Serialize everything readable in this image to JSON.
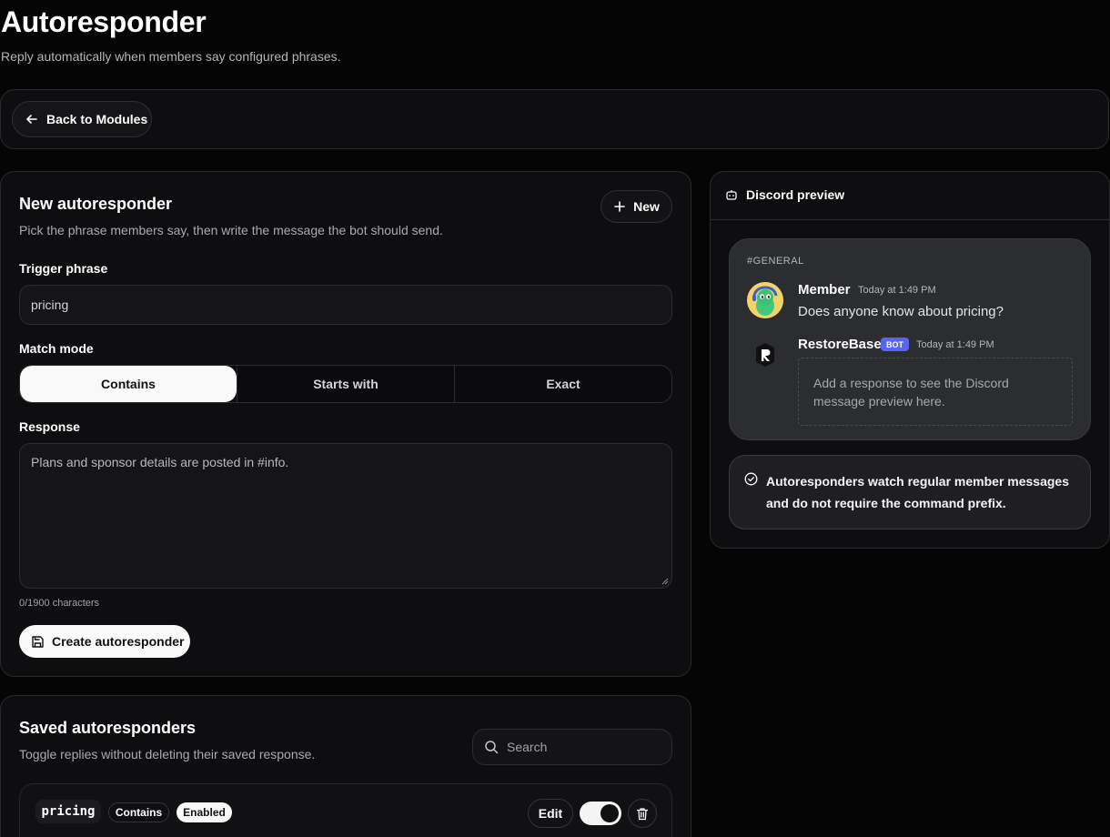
{
  "header": {
    "title": "Autoresponder",
    "subtitle": "Reply automatically when members say configured phrases."
  },
  "nav": {
    "back_label": "Back to Modules",
    "back_icon": "arrow-left-icon"
  },
  "create": {
    "title": "New autoresponder",
    "subtitle": "Pick the phrase members say, then write the message the bot should send.",
    "new_label": "New",
    "trigger_label": "Trigger phrase",
    "trigger_value": "pricing",
    "match_label": "Match mode",
    "match_modes": [
      "Contains",
      "Starts with",
      "Exact"
    ],
    "match_selected": "Contains",
    "response_label": "Response",
    "response_placeholder": "Plans and sponsor details are posted in #info.",
    "response_value": "",
    "char_count": "0/1900 characters",
    "submit_label": "Create autoresponder"
  },
  "saved": {
    "title": "Saved autoresponders",
    "subtitle": "Toggle replies without deleting their saved response.",
    "search_placeholder": "Search",
    "items": [
      {
        "trigger": "pricing",
        "mode": "Contains",
        "status": "Enabled",
        "enabled": true,
        "edit_label": "Edit"
      }
    ]
  },
  "preview": {
    "title": "Discord preview",
    "channel": "#GENERAL",
    "member": {
      "name": "Member",
      "time": "Today at 1:49 PM",
      "message": "Does anyone know about pricing?"
    },
    "bot": {
      "name": "RestoreBase",
      "badge": "BOT",
      "time": "Today at 1:49 PM",
      "placeholder": "Add a response to see the Discord message preview here."
    },
    "info": "Autoresponders watch regular member messages and do not require the command prefix."
  },
  "colors": {
    "background": "#050506",
    "panel": "#0e0e10",
    "discord": "#2c2d31",
    "bot_badge": "#5865f2",
    "accent": "#f9f9fa"
  }
}
